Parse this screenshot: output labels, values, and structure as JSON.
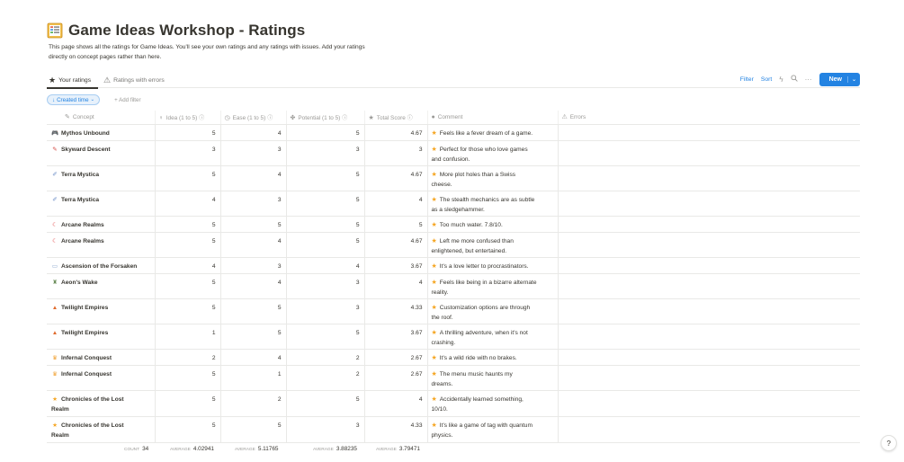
{
  "page": {
    "title": "Game Ideas Workshop - Ratings",
    "description_line1": "This page shows all the ratings for Game Ideas. You'll see your own ratings and any ratings with issues. Add your ratings",
    "description_line2": "directly on concept pages rather than here.",
    "title_icon": "notebook-icon"
  },
  "tabs": [
    {
      "label": "Your ratings",
      "icon": "star-icon",
      "active": true
    },
    {
      "label": "Ratings with errors",
      "icon": "warning-icon",
      "active": false
    }
  ],
  "actions": {
    "filter": "Filter",
    "sort": "Sort",
    "new": "New",
    "accent": "#2383e2"
  },
  "filters": {
    "created_time": "Created time",
    "add_filter": "+ Add filter"
  },
  "columns": {
    "concept": "Concept",
    "idea": "Idea (1 to 5)",
    "ease": "Ease (1 to 5)",
    "potential": "Potential (1 to 5)",
    "total": "Total Score",
    "comment": "Comment",
    "errors": "Errors"
  },
  "rows": [
    {
      "concept": "Mythos Unbound",
      "icon": "🎮",
      "icon_color": "#555",
      "idea": "5",
      "ease": "4",
      "potential": "5",
      "total": "4.67",
      "comment_1": "Feels like a fever dream of a game.",
      "comment_2": ""
    },
    {
      "concept": "Skyward Descent",
      "icon": "✎",
      "icon_color": "#d44c47",
      "idea": "3",
      "ease": "3",
      "potential": "3",
      "total": "3",
      "comment_1": "Perfect for those who love games",
      "comment_2": "and confusion."
    },
    {
      "concept": "Terra Mystica",
      "icon": "✐",
      "icon_color": "#6e8fc7",
      "idea": "5",
      "ease": "4",
      "potential": "5",
      "total": "4.67",
      "comment_1": "More plot holes than a Swiss",
      "comment_2": "cheese."
    },
    {
      "concept": "Terra Mystica",
      "icon": "✐",
      "icon_color": "#6e8fc7",
      "idea": "4",
      "ease": "3",
      "potential": "5",
      "total": "4",
      "comment_1": "The stealth mechanics are as subtle",
      "comment_2": "as a sledgehammer."
    },
    {
      "concept": "Arcane Realms",
      "icon": "☾",
      "icon_color": "#e03e3e",
      "idea": "5",
      "ease": "5",
      "potential": "5",
      "total": "5",
      "comment_1": "Too much water. 7.8/10.",
      "comment_2": ""
    },
    {
      "concept": "Arcane Realms",
      "icon": "☾",
      "icon_color": "#e03e3e",
      "idea": "5",
      "ease": "4",
      "potential": "5",
      "total": "4.67",
      "comment_1": "Left me more confused than",
      "comment_2": "enlightened, but entertained."
    },
    {
      "concept": "Ascension of the Forsaken",
      "icon": "▭",
      "icon_color": "#8aa8cf",
      "idea": "4",
      "ease": "3",
      "potential": "4",
      "total": "3.67",
      "comment_1": "It's a love letter to procrastinators.",
      "comment_2": ""
    },
    {
      "concept": "Aeon's Wake",
      "icon": "♜",
      "icon_color": "#6b8e5a",
      "idea": "5",
      "ease": "4",
      "potential": "3",
      "total": "4",
      "comment_1": "Feels like being in a bizarre alternate",
      "comment_2": "reality."
    },
    {
      "concept": "Twilight Empires",
      "icon": "▲",
      "icon_color": "#e06a2c",
      "idea": "5",
      "ease": "5",
      "potential": "3",
      "total": "4.33",
      "comment_1": "Customization options are through",
      "comment_2": "the roof."
    },
    {
      "concept": "Twilight Empires",
      "icon": "▲",
      "icon_color": "#e06a2c",
      "idea": "1",
      "ease": "5",
      "potential": "5",
      "total": "3.67",
      "comment_1": "A thrilling adventure, when it's not",
      "comment_2": "crashing."
    },
    {
      "concept": "Infernal Conquest",
      "icon": "♛",
      "icon_color": "#f0a030",
      "idea": "2",
      "ease": "4",
      "potential": "2",
      "total": "2.67",
      "comment_1": "It's a wild ride with no brakes.",
      "comment_2": ""
    },
    {
      "concept": "Infernal Conquest",
      "icon": "♛",
      "icon_color": "#f0a030",
      "idea": "5",
      "ease": "1",
      "potential": "2",
      "total": "2.67",
      "comment_1": "The menu music haunts my",
      "comment_2": "dreams."
    },
    {
      "concept": "Chronicles of the Lost",
      "concept_2": "Realm",
      "icon": "★",
      "icon_color": "#f5a623",
      "idea": "5",
      "ease": "2",
      "potential": "5",
      "total": "4",
      "comment_1": "Accidentally learned something,",
      "comment_2": "10/10."
    },
    {
      "concept": "Chronicles of the Lost",
      "concept_2": "Realm",
      "icon": "★",
      "icon_color": "#f5a623",
      "idea": "5",
      "ease": "5",
      "potential": "3",
      "total": "4.33",
      "comment_1": "It's like a game of tag with quantum",
      "comment_2": "physics."
    }
  ],
  "footer": {
    "count_label": "COUNT",
    "count_value": "34",
    "avg_label": "AVERAGE",
    "avg_idea": "4.02941",
    "avg_ease": "5.11765",
    "avg_potential": "3.88235",
    "avg_total": "3.79471"
  },
  "help": "?"
}
